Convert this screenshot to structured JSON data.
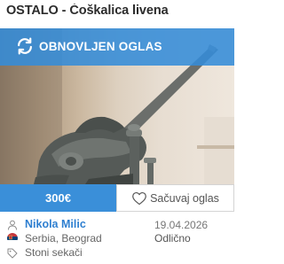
{
  "listing": {
    "category_title": "OSTALO - Ćoškalica livena",
    "status_banner": "OBNOVLJEN OGLAS",
    "price": "300€",
    "save_label": "Sačuvaj oglas",
    "seller_name": "Nikola Milic",
    "location": "Serbia, Beograd",
    "category": "Stoni sekači",
    "date": "19.04.2026",
    "condition": "Odlično"
  },
  "colors": {
    "accent": "#3a8fd9",
    "banner": "#348cd8",
    "seller_link": "#2e7fd0"
  },
  "icons": {
    "banner": "refresh-icon",
    "save": "heart-outline-icon",
    "seller": "user-icon",
    "location": "serbia-flag-icon",
    "category": "tag-icon"
  }
}
